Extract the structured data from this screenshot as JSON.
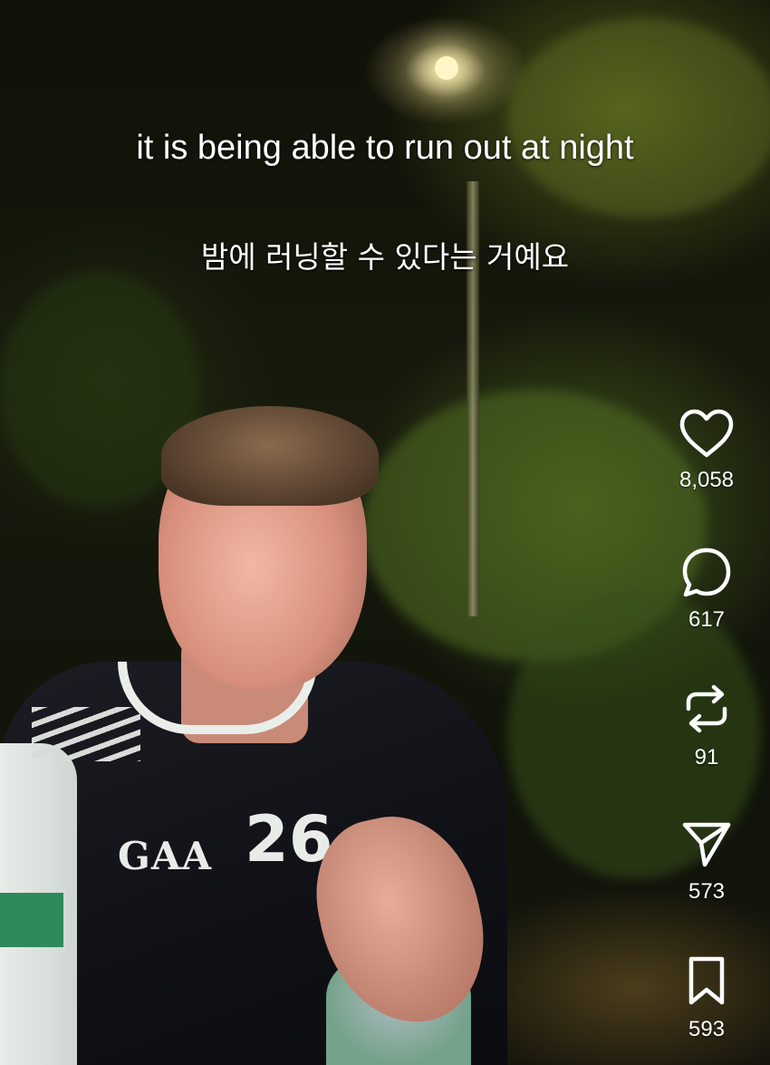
{
  "caption": {
    "english": "it is being able to run out at night",
    "korean": "밤에 러닝할 수 있다는 거예요"
  },
  "jersey": {
    "logo": "GAA",
    "number": "26"
  },
  "actions": {
    "like": {
      "icon": "heart-icon",
      "count": "8,058"
    },
    "comment": {
      "icon": "speech-bubble-icon",
      "count": "617"
    },
    "repost": {
      "icon": "repost-arrows-icon",
      "count": "91"
    },
    "share": {
      "icon": "send-icon",
      "count": "573"
    },
    "save": {
      "icon": "bookmark-icon",
      "count": "593"
    }
  },
  "colors": {
    "icon": "#ffffff",
    "text": "#ffffff"
  }
}
